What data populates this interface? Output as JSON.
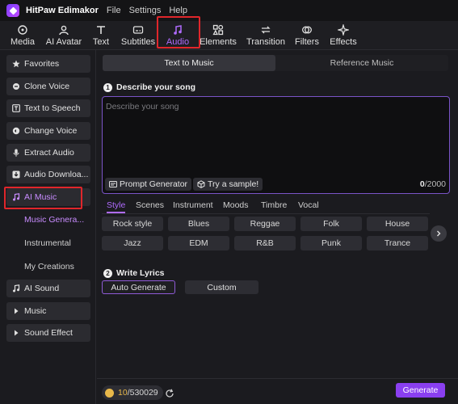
{
  "app": {
    "title": "HitPaw Edimakor"
  },
  "menu": [
    "File",
    "Settings",
    "Help"
  ],
  "toolbar": [
    {
      "label": "Media",
      "icon": "media-icon"
    },
    {
      "label": "AI Avatar",
      "icon": "ai-avatar-icon"
    },
    {
      "label": "Text",
      "icon": "text-icon"
    },
    {
      "label": "Subtitles",
      "icon": "subtitles-icon"
    },
    {
      "label": "Audio",
      "icon": "audio-icon",
      "active": true
    },
    {
      "label": "Elements",
      "icon": "elements-icon"
    },
    {
      "label": "Transition",
      "icon": "transition-icon"
    },
    {
      "label": "Filters",
      "icon": "filters-icon"
    },
    {
      "label": "Effects",
      "icon": "effects-icon"
    }
  ],
  "sidebar": {
    "items": [
      {
        "label": "Favorites",
        "icon": "star-icon"
      },
      {
        "label": "Clone Voice",
        "icon": "clone-voice-icon"
      },
      {
        "label": "Text to Speech",
        "icon": "text-to-speech-icon"
      },
      {
        "label": "Change Voice",
        "icon": "change-voice-icon"
      },
      {
        "label": "Extract Audio",
        "icon": "microphone-icon"
      },
      {
        "label": "Audio Downloa...",
        "icon": "download-icon"
      },
      {
        "label": "AI Music",
        "icon": "music-note-icon",
        "selected": true
      },
      {
        "label": "AI Sound",
        "icon": "ai-sound-icon"
      },
      {
        "label": "Music",
        "icon": "caret-right-icon"
      },
      {
        "label": "Sound Effect",
        "icon": "caret-right-icon"
      }
    ],
    "ai_music_sub": [
      "Music Genera...",
      "Instrumental",
      "My Creations"
    ]
  },
  "main": {
    "tabs": [
      "Text to Music",
      "Reference Music"
    ],
    "describe": {
      "number": "1",
      "title": "Describe your song",
      "placeholder": "Describe your song",
      "prompt_generator": "Prompt Generator",
      "try_sample": "Try a sample!",
      "count_used": "0",
      "count_max": "/2000"
    },
    "tag_tabs": [
      "Style",
      "Scenes",
      "Instrument",
      "Moods",
      "Timbre",
      "Vocal"
    ],
    "styles": [
      "Rock style",
      "Blues",
      "Reggae",
      "Folk",
      "House",
      "Jazz",
      "EDM",
      "R&B",
      "Punk",
      "Trance"
    ],
    "lyrics": {
      "number": "2",
      "title": "Write Lyrics",
      "auto": "Auto Generate",
      "custom": "Custom"
    },
    "credits": {
      "used": "10",
      "total": "/530029"
    },
    "generate": "Generate"
  },
  "colors": {
    "accent": "#b06bff",
    "generate_bg": "#8a3ff0",
    "highlight": "#e0262b"
  }
}
